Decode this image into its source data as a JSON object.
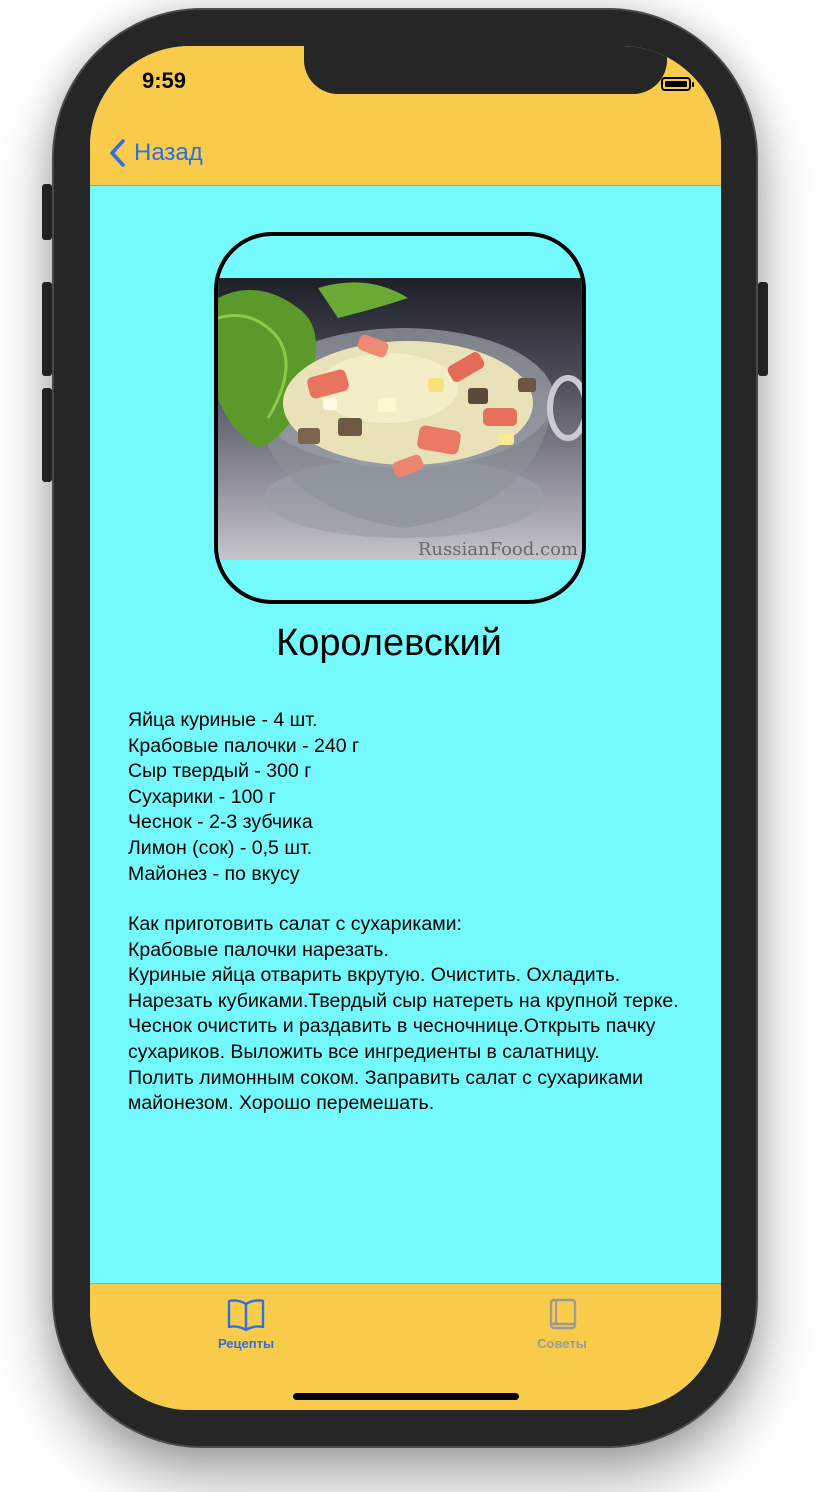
{
  "status_bar": {
    "time": "9:59",
    "signal_dots": "....."
  },
  "nav": {
    "back_label": "Назад"
  },
  "recipe": {
    "photo_watermark": "RussianFood.com",
    "title": "Королевский",
    "ingredients": [
      "Яйца куриные - 4 шт.",
      "Крабовые палочки - 240 г",
      "Сыр твердый - 300 г",
      "Сухарики - 100 г",
      "Чеснок - 2-3 зубчика",
      "Лимон (сок) - 0,5 шт.",
      "Майонез - по вкусу"
    ],
    "instructions": [
      "Как приготовить салат с сухариками:",
      "Крабовые палочки нарезать.",
      "Куриные яйца отварить вкрутую. Очистить. Охладить. Нарезать кубиками.Твердый сыр натереть на крупной терке.",
      "Чеснок очистить и раздавить в чесночнице.Открыть пачку сухариков. Выложить все ингредиенты в салатницу.",
      "Полить лимонным соком. Заправить салат с сухариками майонезом. Хорошо перемешать."
    ]
  },
  "tabs": [
    {
      "label": "Рецепты",
      "icon": "book-open-icon",
      "selected": true
    },
    {
      "label": "Советы",
      "icon": "book-closed-icon",
      "selected": false
    }
  ],
  "colors": {
    "bar_background": "#f8cc4a",
    "content_background": "#74fafc",
    "accent": "#2f6fe0",
    "inactive": "#9a9a9a"
  }
}
